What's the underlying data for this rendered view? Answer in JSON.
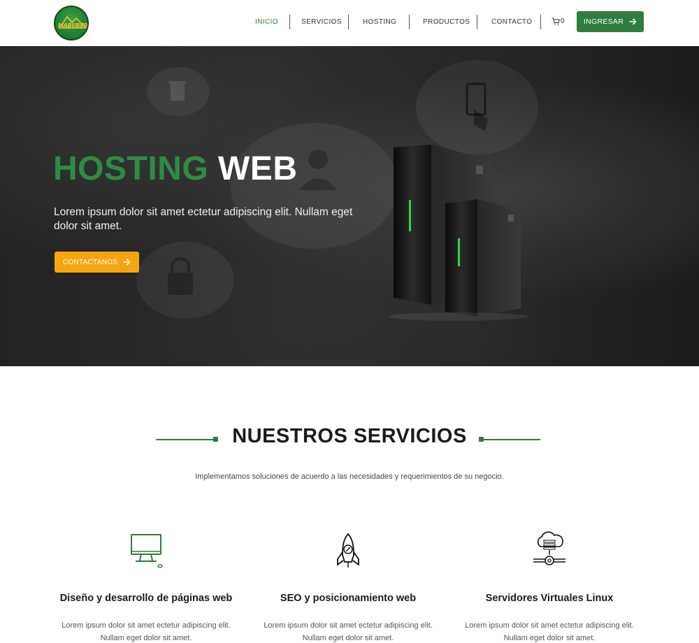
{
  "header": {
    "logo_text": "MABUBER",
    "nav": [
      "INICIO",
      "SERVICIOS",
      "HOSTING",
      "PRODUCTOS",
      "CONTACTO"
    ],
    "active_nav": "INICIO",
    "cart_count": "0",
    "login_label": "INGRESAR"
  },
  "hero": {
    "title_green": "HOSTING",
    "title_white": "WEB",
    "text": "Lorem ipsum dolor sit amet ectetur adipiscing elit. Nullam eget dolor sit amet.",
    "button_label": "CONTACTANOS"
  },
  "services": {
    "title": "NUESTROS SERVICIOS",
    "subtitle": "Implementamos soluciones de acuerdo a las necesidades y requerimientos de su negocio.",
    "items": [
      {
        "icon": "monitor-icon",
        "title": "Diseño y desarrollo de páginas web",
        "desc_line1": "Lorem ipsum dolor sit amet ectetur adipiscing elit.",
        "desc_line2": "Nullam eget dolor sit amet."
      },
      {
        "icon": "rocket-icon",
        "title": "SEO y posicionamiento web",
        "desc_line1": "Lorem ipsum dolor sit amet ectetur adipiscing elit.",
        "desc_line2": "Nullam eget dolor sit amet."
      },
      {
        "icon": "cloud-server-icon",
        "title": "Servidores Virtuales Linux",
        "desc_line1": "Lorem ipsum dolor sit amet ectetur adipiscing elit.",
        "desc_line2": "Nullam eget dolor sit amet."
      }
    ]
  },
  "colors": {
    "brand_green": "#2e7d3f",
    "accent_orange": "#f5a60f",
    "hero_dark": "#1e1e1e"
  }
}
